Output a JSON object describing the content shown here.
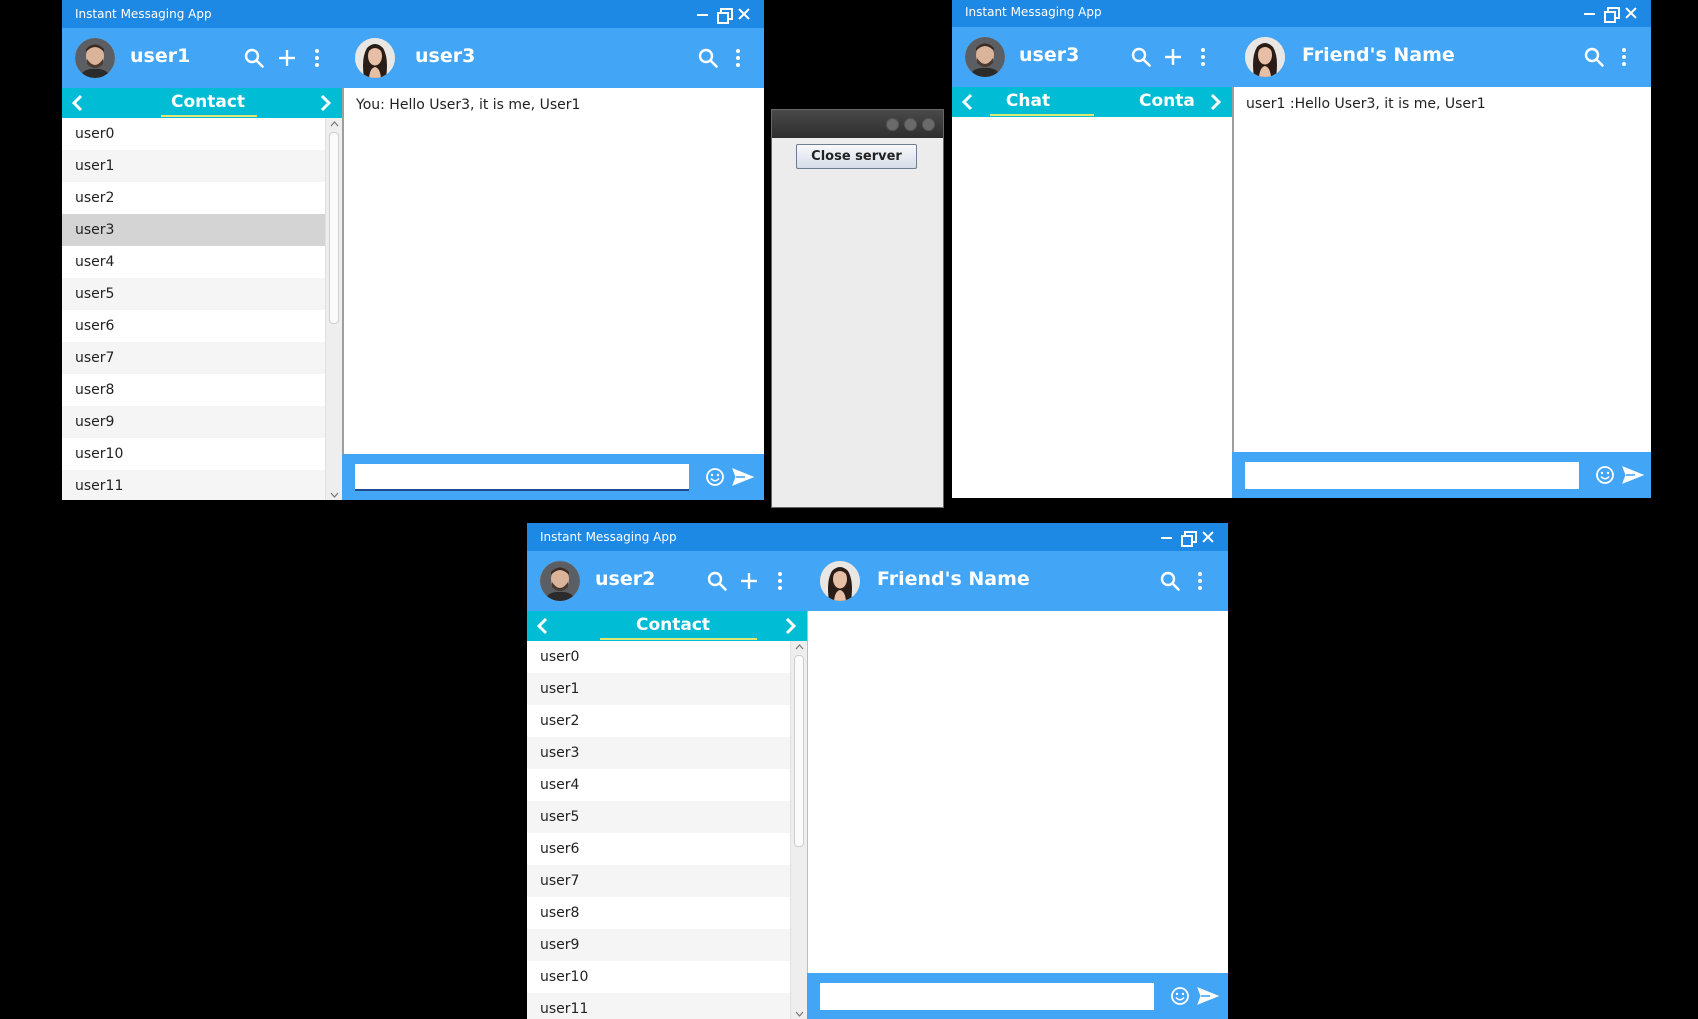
{
  "window1": {
    "title": "Instant Messaging App",
    "user_name": "user1",
    "tab_label": "Contact",
    "friend_name": "user3",
    "contacts": [
      "user0",
      "user1",
      "user2",
      "user3",
      "user4",
      "user5",
      "user6",
      "user7",
      "user8",
      "user9",
      "user10",
      "user11"
    ],
    "selected_contact": "user3",
    "message": "You: Hello User3, it is me, User1"
  },
  "window2": {
    "title": "Instant Messaging App",
    "user_name": "user3",
    "tab_label": "Chat",
    "tab_label_next": "Conta",
    "friend_name": "Friend's Name",
    "message": "user1 :Hello User3, it is me, User1"
  },
  "window3": {
    "title": "Instant Messaging App",
    "user_name": "user2",
    "tab_label": "Contact",
    "friend_name": "Friend's Name",
    "contacts": [
      "user0",
      "user1",
      "user2",
      "user3",
      "user4",
      "user5",
      "user6",
      "user7",
      "user8",
      "user9",
      "user10",
      "user11"
    ]
  },
  "server": {
    "button_label": "Close server"
  },
  "colors": {
    "titlebar": "#1e88e5",
    "header": "#42a5f5",
    "tabbar": "#00bcd4",
    "tab_underline": "#dce775",
    "selected_row": "#d4d4d4"
  },
  "icons": [
    "search-icon",
    "plus-icon",
    "more-vert-icon",
    "chevron-left-icon",
    "chevron-right-icon",
    "emoji-icon",
    "send-icon",
    "minimize-icon",
    "restore-icon",
    "close-icon"
  ]
}
